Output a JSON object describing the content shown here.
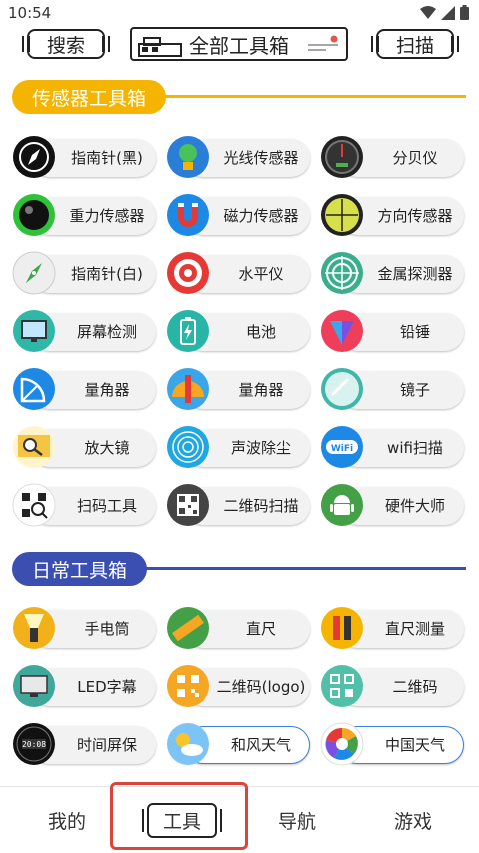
{
  "status": {
    "time": "10:54"
  },
  "topbar": {
    "search": "搜索",
    "title": "全部工具箱",
    "scan": "扫描"
  },
  "sensor_section": {
    "label": "传感器工具箱",
    "color": "#f5b400",
    "tools": [
      {
        "label": "指南针(黑)",
        "icon": "compass-black-icon",
        "color": "#111111"
      },
      {
        "label": "光线传感器",
        "icon": "light-sensor-icon",
        "color": "#2a7ed8"
      },
      {
        "label": "分贝仪",
        "icon": "decibel-meter-icon",
        "color": "#222222"
      },
      {
        "label": "重力传感器",
        "icon": "gravity-ball-icon",
        "color": "#2ec13a"
      },
      {
        "label": "磁力传感器",
        "icon": "magnet-icon",
        "color": "#1e88e5"
      },
      {
        "label": "方向传感器",
        "icon": "level-bubble-icon",
        "color": "#c9d23a"
      },
      {
        "label": "指南针(白)",
        "icon": "compass-white-icon",
        "color": "#eeeeee"
      },
      {
        "label": "水平仪",
        "icon": "target-level-icon",
        "color": "#e53935"
      },
      {
        "label": "金属探测器",
        "icon": "metal-detector-icon",
        "color": "#3aae8c"
      },
      {
        "label": "屏幕检测",
        "icon": "screen-test-icon",
        "color": "#2fb8a8"
      },
      {
        "label": "电池",
        "icon": "battery-icon",
        "color": "#28b5a6"
      },
      {
        "label": "铅锤",
        "icon": "plumb-icon",
        "color": "#ef3e5a"
      },
      {
        "label": "量角器",
        "icon": "protractor-icon",
        "color": "#1e88e5"
      },
      {
        "label": "量角器",
        "icon": "protractor-ruler-icon",
        "color": "#3aa6e8"
      },
      {
        "label": "镜子",
        "icon": "mirror-icon",
        "color": "#40b6a8"
      },
      {
        "label": "放大镜",
        "icon": "magnifier-icon",
        "color": "#f4c542"
      },
      {
        "label": "声波除尘",
        "icon": "sound-wave-icon",
        "color": "#1ea7e0"
      },
      {
        "label": "wifi扫描",
        "icon": "wifi-icon",
        "color": "#1e88e5"
      },
      {
        "label": "扫码工具",
        "icon": "scan-code-icon",
        "color": "#ffffff"
      },
      {
        "label": "二维码扫描",
        "icon": "qr-scan-icon",
        "color": "#444444"
      },
      {
        "label": "硬件大师",
        "icon": "android-icon",
        "color": "#43a047"
      }
    ]
  },
  "daily_section": {
    "label": "日常工具箱",
    "color": "#3a4fb0",
    "tools": [
      {
        "label": "手电筒",
        "icon": "flashlight-icon",
        "color": "#f2b019"
      },
      {
        "label": "直尺",
        "icon": "ruler-icon",
        "color": "#43a047"
      },
      {
        "label": "直尺测量",
        "icon": "ruler-measure-icon",
        "color": "#f4b400"
      },
      {
        "label": "LED字幕",
        "icon": "led-monitor-icon",
        "color": "#40a89a"
      },
      {
        "label": "二维码(logo)",
        "icon": "qr-logo-icon",
        "color": "#f5a623"
      },
      {
        "label": "二维码",
        "icon": "qr-code-icon",
        "color": "#52c0a8"
      },
      {
        "label": "时间屏保",
        "icon": "clock-screen-icon",
        "color": "#111111"
      },
      {
        "label": "和风天气",
        "icon": "weather-sun-icon",
        "color": "#3a9cf0"
      },
      {
        "label": "中国天气",
        "icon": "china-weather-icon",
        "color": "#ffffff"
      }
    ]
  },
  "bottom_nav": {
    "tabs": [
      {
        "label": "我的"
      },
      {
        "label": "工具"
      },
      {
        "label": "导航"
      },
      {
        "label": "游戏"
      }
    ],
    "active": "工具"
  }
}
